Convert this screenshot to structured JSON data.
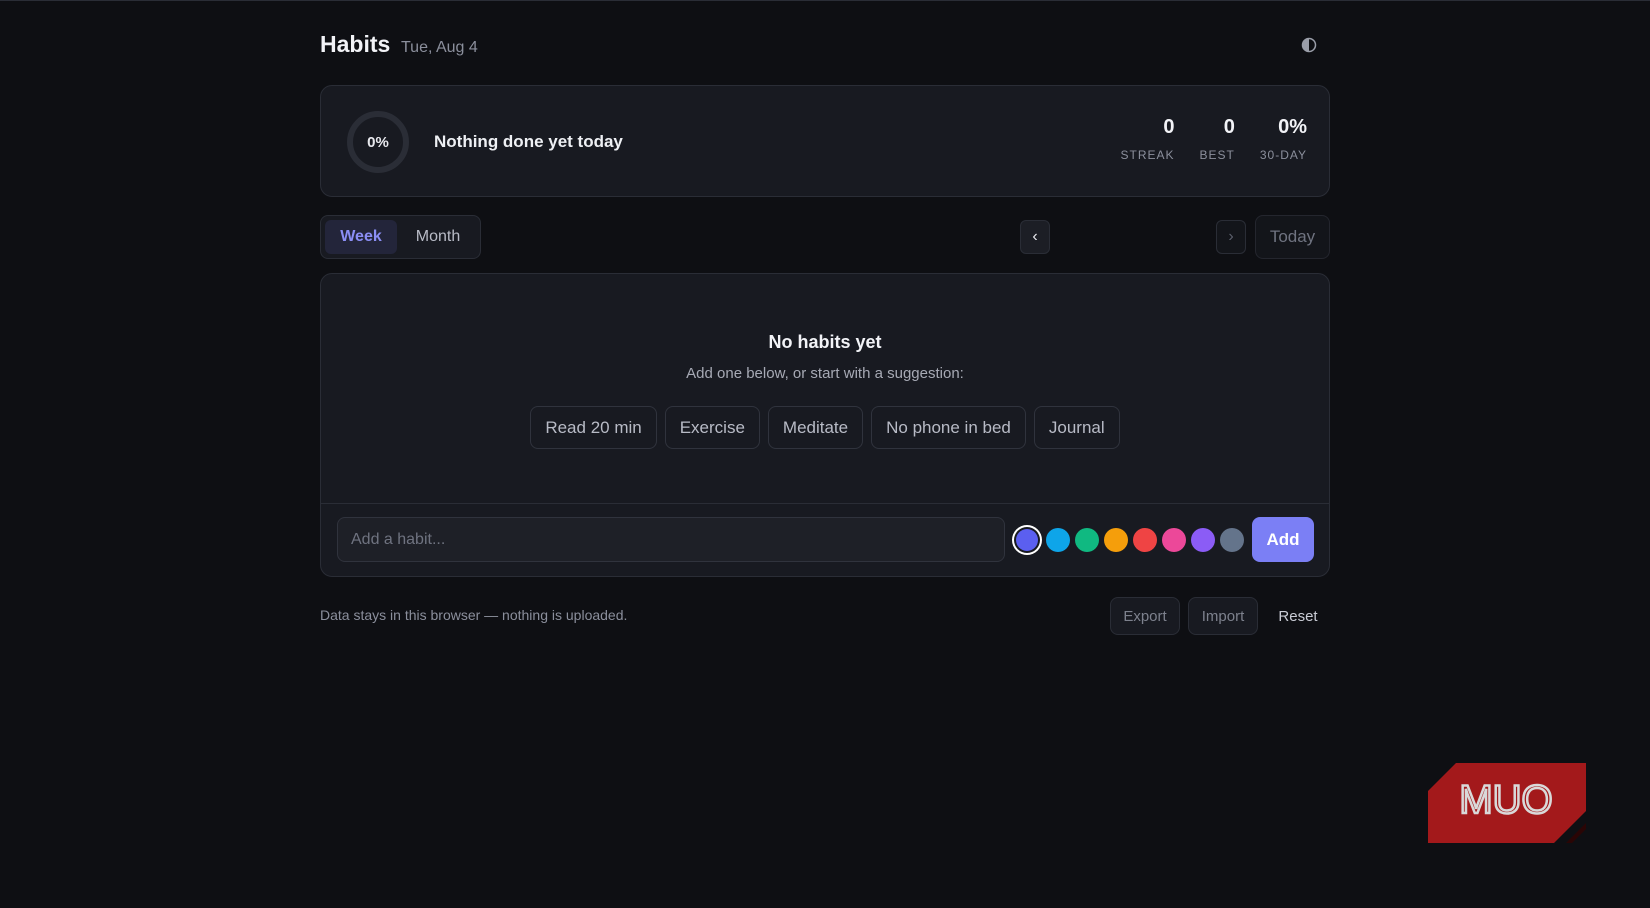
{
  "header": {
    "title": "Habits",
    "date": "Tue, Aug 4",
    "theme_icon": "half-circle-contrast-icon"
  },
  "summary": {
    "progress_percent": 0,
    "progress_label": "0%",
    "message": "Nothing done yet today",
    "stats": [
      {
        "value": "0",
        "label": "STREAK"
      },
      {
        "value": "0",
        "label": "BEST"
      },
      {
        "value": "0%",
        "label": "30-DAY"
      }
    ]
  },
  "view": {
    "options": [
      "Week",
      "Month"
    ],
    "selected": "Week",
    "prev_icon": "‹",
    "next_icon": "›",
    "today_label": "Today"
  },
  "empty_state": {
    "title": "No habits yet",
    "subtitle": "Add one below, or start with a suggestion:",
    "suggestions": [
      "Read 20 min",
      "Exercise",
      "Meditate",
      "No phone in bed",
      "Journal"
    ]
  },
  "add_form": {
    "placeholder": "Add a habit...",
    "value": "",
    "colors": [
      "#5b5ff0",
      "#0ea5e9",
      "#10b981",
      "#f59e0b",
      "#ef4444",
      "#ec4899",
      "#8b5cf6",
      "#64748b"
    ],
    "selected_color": "#5b5ff0",
    "add_label": "Add"
  },
  "footer": {
    "note": "Data stays in this browser — nothing is uploaded.",
    "export_label": "Export",
    "import_label": "Import",
    "reset_label": "Reset"
  },
  "watermark": {
    "text": "MUO",
    "color": "#a3191b"
  }
}
